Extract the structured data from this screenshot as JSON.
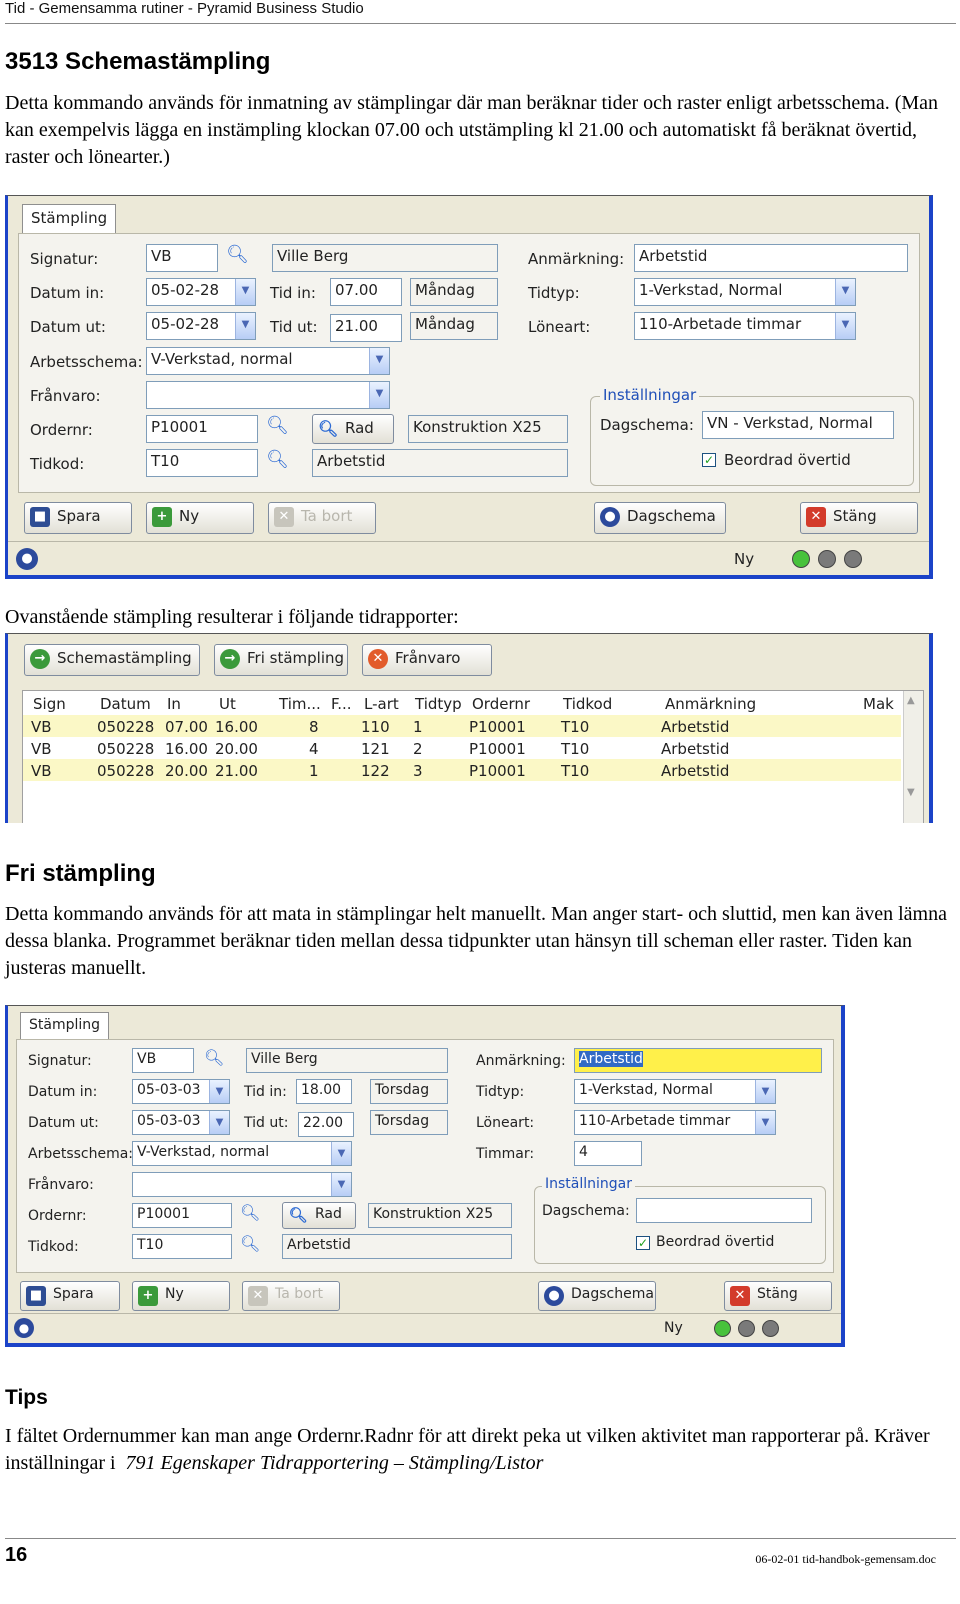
{
  "header": {
    "title": "Tid - Gemensamma rutiner - Pyramid Business Studio"
  },
  "section1": {
    "heading": "3513 Schemastämpling",
    "paragraph": "Detta kommando används för inmatning av stämplingar där man beräknar tider och raster enligt arbetsschema. (Man kan exempelvis lägga en instämpling klockan 07.00 och utstämpling kl 21.00 och automatiskt få beräknat övertid, raster och lönearter.)"
  },
  "form1": {
    "tab": "Stämpling",
    "signatur_label": "Signatur:",
    "signatur": "VB",
    "name": "Ville Berg",
    "datum_in_label": "Datum in:",
    "datum_in": "05-02-28",
    "tid_in_label": "Tid in:",
    "tid_in": "07.00",
    "dag_in": "Måndag",
    "datum_ut_label": "Datum ut:",
    "datum_ut": "05-02-28",
    "tid_ut_label": "Tid ut:",
    "tid_ut": "21.00",
    "dag_ut": "Måndag",
    "arbetsschema_label": "Arbetsschema:",
    "arbetsschema": "V-Verkstad, normal",
    "franvaro_label": "Frånvaro:",
    "franvaro": "",
    "ordernr_label": "Ordernr:",
    "ordernr": "P10001",
    "rad_button": "Rad",
    "order_name": "Konstruktion X25",
    "tidkod_label": "Tidkod:",
    "tidkod": "T10",
    "tidkod_name": "Arbetstid",
    "anmarkning_label": "Anmärkning:",
    "anmarkning": "Arbetstid",
    "tidtyp_label": "Tidtyp:",
    "tidtyp": "1-Verkstad, Normal",
    "loneart_label": "Löneart:",
    "loneart": "110-Arbetade timmar",
    "installningar_label": "Inställningar",
    "dagschema_label": "Dagschema:",
    "dagschema": "VN - Verkstad, Normal",
    "beordrad_label": "Beordrad övertid",
    "buttons": {
      "spara": "Spara",
      "ny": "Ny",
      "tabort": "Ta bort",
      "dagschema": "Dagschema",
      "stang": "Stäng"
    },
    "status": "Ny"
  },
  "section2": {
    "text": "Ovanstående stämpling resulterar i följande tidrapporter:"
  },
  "report": {
    "tabs": [
      "Schemastämpling",
      "Fri stämpling",
      "Frånvaro"
    ],
    "columns": [
      "Sign",
      "Datum",
      "In",
      "Ut",
      "Tim...",
      "F...",
      "L-art",
      "Tidtyp",
      "Ordernr",
      "Tidkod",
      "Anmärkning",
      "Mak"
    ],
    "rows": [
      [
        "VB",
        "050228",
        "07.00",
        "16.00",
        "8",
        "",
        "110",
        "1",
        "P10001",
        "T10",
        "Arbetstid"
      ],
      [
        "VB",
        "050228",
        "16.00",
        "20.00",
        "4",
        "",
        "121",
        "2",
        "P10001",
        "T10",
        "Arbetstid"
      ],
      [
        "VB",
        "050228",
        "20.00",
        "21.00",
        "1",
        "",
        "122",
        "3",
        "P10001",
        "T10",
        "Arbetstid"
      ]
    ]
  },
  "section3": {
    "heading": "Fri stämpling",
    "paragraph": "Detta kommando används för att mata in stämplingar helt manuellt. Man anger start- och sluttid, men kan även lämna dessa blanka. Programmet beräknar tiden mellan dessa tidpunkter utan hänsyn till scheman eller raster. Tiden kan justeras manuellt."
  },
  "form2": {
    "tab": "Stämpling",
    "signatur_label": "Signatur:",
    "signatur": "VB",
    "name": "Ville Berg",
    "datum_in_label": "Datum in:",
    "datum_in": "05-03-03",
    "tid_in_label": "Tid in:",
    "tid_in": "18.00",
    "dag_in": "Torsdag",
    "datum_ut_label": "Datum ut:",
    "datum_ut": "05-03-03",
    "tid_ut_label": "Tid ut:",
    "tid_ut": "22.00",
    "dag_ut": "Torsdag",
    "arbetsschema_label": "Arbetsschema:",
    "arbetsschema": "V-Verkstad, normal",
    "franvaro_label": "Frånvaro:",
    "franvaro": "",
    "ordernr_label": "Ordernr:",
    "ordernr": "P10001",
    "rad_button": "Rad",
    "order_name": "Konstruktion X25",
    "tidkod_label": "Tidkod:",
    "tidkod": "T10",
    "tidkod_name": "Arbetstid",
    "anmarkning_label": "Anmärkning:",
    "anmarkning": "Arbetstid",
    "tidtyp_label": "Tidtyp:",
    "tidtyp": "1-Verkstad, Normal",
    "loneart_label": "Löneart:",
    "loneart": "110-Arbetade timmar",
    "timmar_label": "Timmar:",
    "timmar": "4",
    "installningar_label": "Inställningar",
    "dagschema_label": "Dagschema:",
    "dagschema": "",
    "beordrad_label": "Beordrad övertid",
    "buttons": {
      "spara": "Spara",
      "ny": "Ny",
      "tabort": "Ta bort",
      "dagschema": "Dagschema",
      "stang": "Stäng"
    },
    "status": "Ny"
  },
  "tips": {
    "heading": "Tips",
    "text1": "I fältet Ordernummer kan man ange Ordernr.Radnr för att direkt peka ut vilken aktivitet man rapporterar på. Kräver inställningar i",
    "text_ref": "791 Egenskaper Tidrapportering – Stämpling/Listor"
  },
  "footer": {
    "page": "16",
    "file": "06-02-01 tid-handbok-gemensam.doc"
  }
}
